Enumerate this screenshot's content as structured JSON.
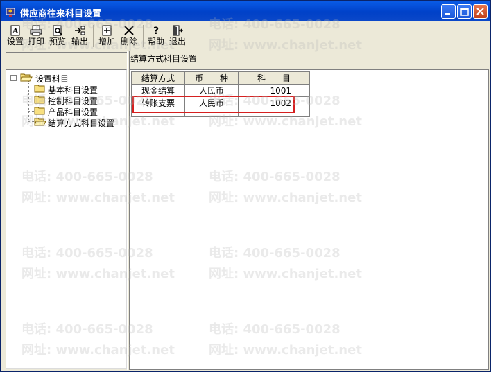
{
  "window": {
    "title": "供应商往来科目设置"
  },
  "toolbar": {
    "buttons": [
      {
        "label": "设置"
      },
      {
        "label": "打印"
      },
      {
        "label": "预览"
      },
      {
        "label": "输出"
      },
      {
        "label": "增加"
      },
      {
        "label": "删除"
      },
      {
        "label": "帮助"
      },
      {
        "label": "退出"
      }
    ]
  },
  "section_label": "结算方式科目设置",
  "tree": {
    "root": "设置科目",
    "children": [
      "基本科目设置",
      "控制科目设置",
      "产品科目设置",
      "结算方式科目设置"
    ]
  },
  "grid": {
    "headers": [
      "结算方式",
      "币　　种",
      "科　　目"
    ],
    "rows": [
      [
        "现金结算",
        "人民币",
        "1001"
      ],
      [
        "转账支票",
        "人民币",
        "1002"
      ],
      [
        "",
        "",
        ""
      ]
    ]
  },
  "watermark": {
    "phone": "电话: 400-665-0028",
    "site": "网址: www.chanjet.net"
  }
}
